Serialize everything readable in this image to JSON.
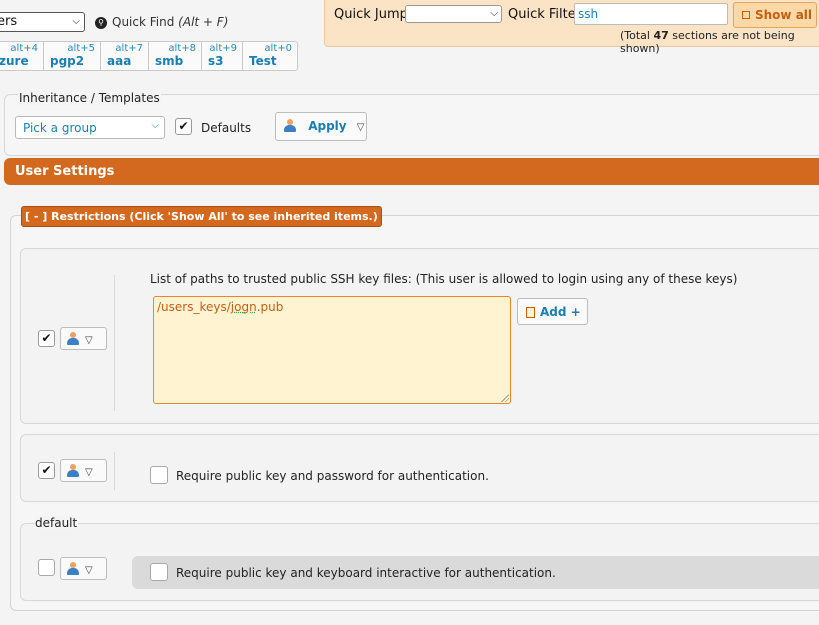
{
  "top": {
    "select_value": "ers",
    "quick_find_label": "Quick Find",
    "quick_find_shortcut": "(Alt + F)"
  },
  "tabs": [
    {
      "shortcut": "alt+4",
      "label": "zure"
    },
    {
      "shortcut": "alt+5",
      "label": "pgp2"
    },
    {
      "shortcut": "alt+7",
      "label": "aaa"
    },
    {
      "shortcut": "alt+8",
      "label": "smb"
    },
    {
      "shortcut": "alt+9",
      "label": "s3"
    },
    {
      "shortcut": "alt+0",
      "label": "Test"
    }
  ],
  "quick": {
    "jump_label": "Quick Jump:",
    "jump_value": "",
    "filter_label": "Quick Filter",
    "filter_value": "ssh",
    "show_all_label": "Show all",
    "total_prefix": "(Total ",
    "total_count": "47",
    "total_suffix": " sections are not being shown)"
  },
  "inheritance": {
    "title": "Inheritance / Templates",
    "group_select_value": "Pick a group",
    "defaults_label": "Defaults",
    "apply_label": "Apply"
  },
  "user_settings": {
    "title": "User Settings"
  },
  "restrictions": {
    "header": "[ - ] Restrictions (Click 'Show All' to see inherited items.)",
    "paths_label": "List of paths to trusted public SSH key files: (This user is allowed to login using any of these keys)",
    "paths_value_prefix": "/users_keys/j",
    "paths_value_squiggle": "ogn",
    "paths_value_suffix": ".pub",
    "add_label": "Add +",
    "req_password_label": "Require public key and password for authentication.",
    "default_label": "default",
    "req_keyboard_label": "Require public key and keyboard interactive for authentication."
  },
  "colors": {
    "accent_orange": "#d2691e",
    "link_blue": "#1a7fb0",
    "quickjump_bg": "#fbe3c6"
  }
}
